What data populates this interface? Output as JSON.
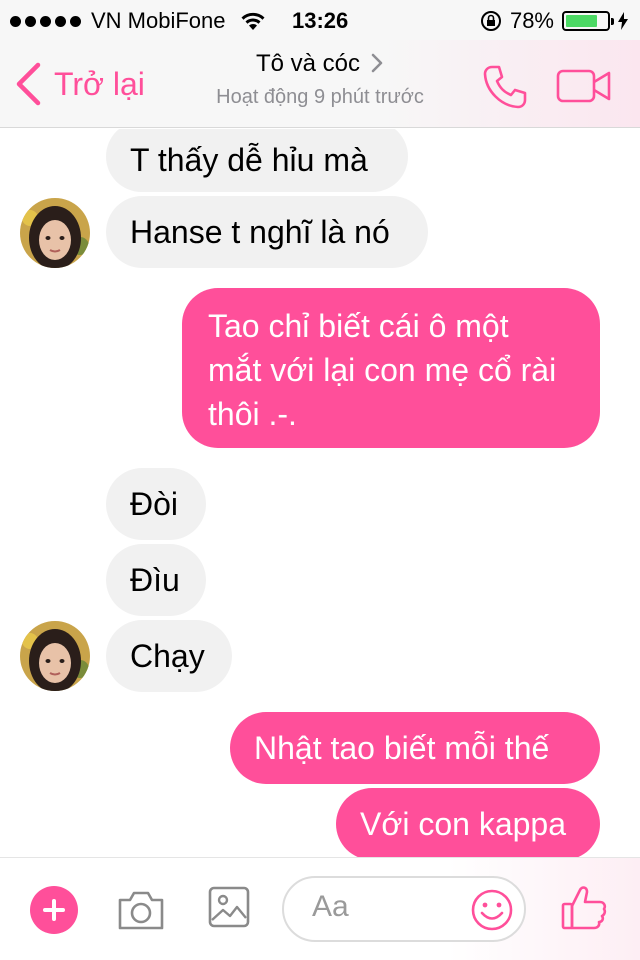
{
  "status_bar": {
    "carrier": "VN MobiFone",
    "time": "13:26",
    "battery_percent": "78%",
    "battery_level": 0.78
  },
  "header": {
    "back_label": "Trở lại",
    "title": "Tô và cóc",
    "subtitle": "Hoạt động 9 phút trước"
  },
  "messages": [
    {
      "direction": "received",
      "lines": [
        "T thấy dễ hỉu mà"
      ]
    },
    {
      "direction": "received",
      "lines": [
        "Hanse t nghĩ là nó"
      ]
    },
    {
      "direction": "sent",
      "lines": [
        "Tao chỉ biết cái ô một",
        "mắt với lại con mẹ cổ rài",
        "thôi .-."
      ]
    },
    {
      "direction": "received",
      "lines": [
        "Đòi"
      ]
    },
    {
      "direction": "received",
      "lines": [
        "Đìu"
      ]
    },
    {
      "direction": "received",
      "lines": [
        "Chạy"
      ]
    },
    {
      "direction": "sent",
      "lines": [
        "Nhật tao biết mỗi thế"
      ]
    },
    {
      "direction": "sent",
      "lines": [
        "Với con kappa"
      ]
    }
  ],
  "composer": {
    "placeholder": "Aa"
  },
  "colors": {
    "accent": "#ff4f9a",
    "received_bubble": "#f1f1f1",
    "battery": "#4cd964"
  },
  "icons": [
    "back-chevron-icon",
    "phone-icon",
    "video-camera-icon",
    "plus-icon",
    "camera-icon",
    "image-icon",
    "emoji-icon",
    "thumbs-up-icon"
  ]
}
